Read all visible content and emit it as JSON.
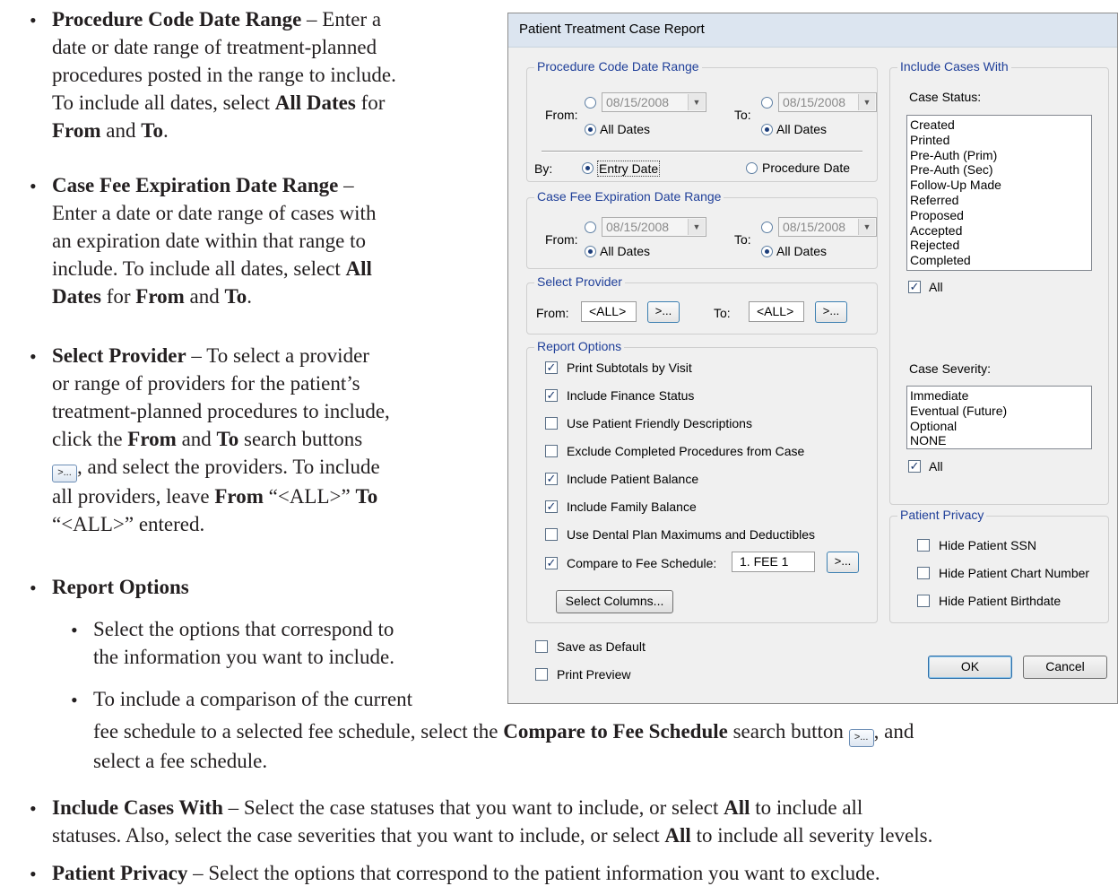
{
  "doc": {
    "item1": {
      "title": "Procedure Code Date Range",
      "lines": [
        " – Enter a",
        "date or date range of treatment-planned",
        "procedures posted in the range to include.",
        "To include all dates, select ",
        "All Dates",
        " for",
        "From",
        " and ",
        "To",
        "."
      ]
    },
    "item2": {
      "title": "Case Fee Expiration Date Range",
      "lines": [
        " –",
        "Enter a date or date range of cases with",
        "an expiration date within that range to",
        "include. To include all dates, select ",
        "All",
        "Dates",
        " for ",
        "From",
        " and ",
        "To",
        "."
      ]
    },
    "item3": {
      "title": "Select Provider",
      "lines": [
        " – To select a provider",
        "or range of providers for the patient’s",
        "treatment-planned procedures to include,",
        "click the ",
        "From",
        " and ",
        "To",
        " search buttons",
        ", and select the providers. To include",
        "all providers, leave ",
        "From",
        " “<ALL>” ",
        "To",
        "“<ALL>” entered."
      ]
    },
    "item4": {
      "title": "Report Options"
    },
    "sub1": [
      "Select the options that correspond to",
      "the information you want to include."
    ],
    "sub2": [
      "To include a comparison of the current",
      "fee schedule to a selected fee schedule, select the ",
      "Compare to Fee Schedule",
      " search button ",
      ", and",
      "select a fee schedule."
    ],
    "item5": {
      "title": "Include Cases With",
      "lines": [
        " – Select the case statuses that you want to include, or select ",
        "All",
        " to include all",
        "statuses. Also, select the case severities that you want to include, or select ",
        "All",
        " to include all severity levels."
      ]
    },
    "item6": {
      "title": "Patient Privacy",
      "lines": [
        " – Select the options that correspond to the patient information you want to exclude."
      ]
    },
    "bullet": "•",
    "inline_button": ">..."
  },
  "dialog": {
    "title": "Patient Treatment Case Report",
    "proc_range": {
      "legend": "Procedure Code Date Range",
      "from": "From:",
      "to": "To:",
      "from_date": "08/15/2008",
      "to_date": "08/15/2008",
      "all_dates": "All Dates",
      "by": "By:",
      "entry_date": "Entry Date",
      "procedure_date": "Procedure Date"
    },
    "fee_range": {
      "legend": "Case Fee Expiration Date Range",
      "from": "From:",
      "to": "To:",
      "from_date": "08/15/2008",
      "to_date": "08/15/2008",
      "all_dates": "All Dates"
    },
    "provider": {
      "legend": "Select Provider",
      "from": "From:",
      "to": "To:",
      "from_value": "<ALL>",
      "to_value": "<ALL>",
      "btn": ">..."
    },
    "report_options": {
      "legend": "Report Options",
      "items": [
        {
          "label": "Print Subtotals by Visit",
          "checked": true
        },
        {
          "label": "Include Finance Status",
          "checked": true
        },
        {
          "label": "Use Patient Friendly Descriptions",
          "checked": false
        },
        {
          "label": "Exclude Completed Procedures from Case",
          "checked": false
        },
        {
          "label": "Include Patient Balance",
          "checked": true
        },
        {
          "label": "Include Family Balance",
          "checked": true
        },
        {
          "label": "Use Dental Plan Maximums and Deductibles",
          "checked": false
        },
        {
          "label": "Compare to Fee Schedule:",
          "checked": true
        }
      ],
      "fee_value": "1.  FEE 1",
      "btn": ">...",
      "select_columns": "Select Columns..."
    },
    "include_cases": {
      "legend": "Include Cases With",
      "case_status": "Case Status:",
      "statuses": [
        "Created",
        "Printed",
        "Pre-Auth (Prim)",
        "Pre-Auth (Sec)",
        "Follow-Up Made",
        "Referred",
        "Proposed",
        "Accepted",
        "Rejected",
        "Completed"
      ],
      "all": "All",
      "case_severity": "Case Severity:",
      "severities": [
        "Immediate",
        "Eventual (Future)",
        "Optional",
        "NONE"
      ]
    },
    "privacy": {
      "legend": "Patient Privacy",
      "items": [
        "Hide Patient SSN",
        "Hide Patient Chart Number",
        "Hide Patient Birthdate"
      ]
    },
    "save_default": "Save as Default",
    "print_preview": "Print Preview",
    "ok": "OK",
    "cancel": "Cancel"
  }
}
